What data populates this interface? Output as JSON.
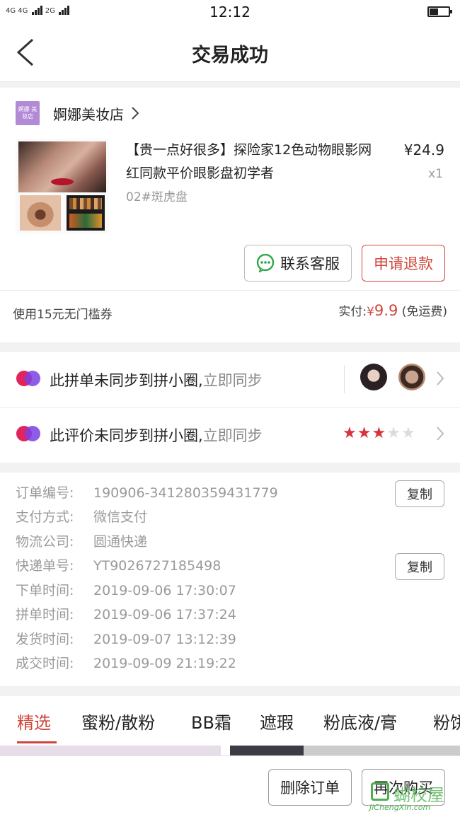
{
  "status_bar": {
    "signal_left": "4G 4G",
    "signal_right": "2G",
    "time": "12:12"
  },
  "nav": {
    "title": "交易成功"
  },
  "shop": {
    "name": "婀娜美妆店",
    "logo_text": "婀娜 美妆店"
  },
  "product": {
    "title": "【贵一点好很多】探险家12色动物眼影网红同款平价眼影盘初学者",
    "spec": "02#斑虎盘",
    "price": "¥24.9",
    "quantity": "x1"
  },
  "actions": {
    "contact_service": "联系客服",
    "request_refund": "申请退款"
  },
  "summary": {
    "coupon": "使用15元无门槛券",
    "paid_label": "实付:",
    "paid_currency": "¥",
    "paid_amount": "9.9",
    "shipping_note": "(免运费)"
  },
  "sync": {
    "group_text": "此拼单未同步到拼小圈,",
    "group_link": "立即同步",
    "review_text": "此评价未同步到拼小圈,",
    "review_link": "立即同步",
    "review_stars": 3,
    "review_stars_max": 5,
    "star_glyph": "★"
  },
  "order_info": {
    "copy_label": "复制",
    "rows": [
      {
        "label": "订单编号:",
        "value": "190906-341280359431779"
      },
      {
        "label": "支付方式:",
        "value": "微信支付"
      },
      {
        "label": "物流公司:",
        "value": "圆通快递"
      },
      {
        "label": "快递单号:",
        "value": "YT9026727185498"
      },
      {
        "label": "下单时间:",
        "value": "2019-09-06 17:30:07"
      },
      {
        "label": "拼单时间:",
        "value": "2019-09-06 17:37:24"
      },
      {
        "label": "发货时间:",
        "value": "2019-09-07 13:12:39"
      },
      {
        "label": "成交时间:",
        "value": "2019-09-09 21:19:22"
      }
    ]
  },
  "tabs": [
    "精选",
    "蜜粉/散粉",
    "BB霜",
    "遮瑕",
    "粉底液/膏",
    "粉饼"
  ],
  "bottom": {
    "delete_order": "删除订单",
    "buy_again": "再次购买"
  },
  "watermark": {
    "cn": "蝴校屋",
    "en": "JiChengXin.com"
  },
  "colors": {
    "accent": "#d0463b",
    "star_on": "#d8333a",
    "star_off": "#dcdcdc"
  }
}
